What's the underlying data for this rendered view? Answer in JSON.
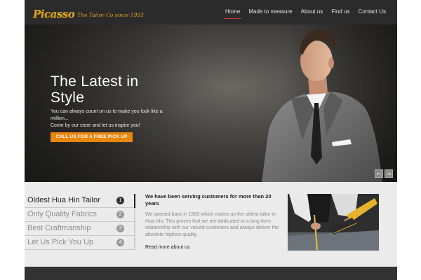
{
  "header": {
    "logo_main": "Picasso",
    "logo_tagline": "The Tailor Co since 1993",
    "nav": [
      {
        "label": "Home",
        "active": true
      },
      {
        "label": "Made to measure",
        "active": false
      },
      {
        "label": "About us",
        "active": false
      },
      {
        "label": "Find us",
        "active": false
      },
      {
        "label": "Contact Us",
        "active": false
      }
    ]
  },
  "hero": {
    "title": "The Latest in Style",
    "text1": "You can always count on us to make you look like a million...",
    "text2": "Come by our store and let us inspire you!",
    "cta": "CALL US FOR A FREE PICK UP",
    "prev_symbol": "←",
    "next_symbol": "→"
  },
  "tabs": [
    {
      "label": "Oldest Hua Hin Tailor",
      "num": "1",
      "active": true
    },
    {
      "label": "Only Quality Fabrics",
      "num": "2",
      "active": false
    },
    {
      "label": "Best Craftmanship",
      "num": "3",
      "active": false
    },
    {
      "label": "Let Us Pick You Up",
      "num": "4",
      "active": false
    }
  ],
  "content": {
    "title": "We have been serving customers for more than 20 years",
    "body": "We opened back in 1993 which makes us the oldest tailor in Hua Hin. This proves that we are dedicated to a long term relationship with our valued customers and always deliver the absolute highest quality.",
    "link": "Read more about us"
  },
  "colors": {
    "header_bg": "#2b2b2b",
    "logo_gold": "#d9a521",
    "nav_active_underline": "#c23a3a",
    "cta_orange": "#e8870e",
    "footer_bg": "#333333"
  }
}
